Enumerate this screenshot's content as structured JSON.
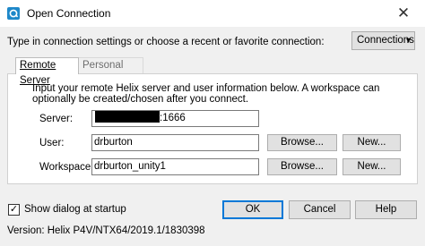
{
  "window": {
    "title": "Open Connection",
    "app_icon": "helix-p4v-icon",
    "close_glyph": "✕"
  },
  "instruction": "Type in connection settings or choose a recent or favorite connection:",
  "connections_button": {
    "label": "Connections",
    "arrow": "▾"
  },
  "tabs": [
    {
      "label": "Remote Server",
      "active": true
    },
    {
      "label": "Personal Server",
      "active": false
    }
  ],
  "panel": {
    "description": "Input your remote Helix server and user information below. A workspace can optionally be created/chosen after you connect.",
    "server": {
      "label": "Server:",
      "value_suffix": ":1666",
      "redacted": true
    },
    "user": {
      "label": "User:",
      "value": "drburton",
      "browse": "Browse...",
      "new": "New..."
    },
    "workspace": {
      "label": "Workspace:",
      "value": "drburton_unity1",
      "browse": "Browse...",
      "new": "New..."
    }
  },
  "show_dialog": {
    "label": "Show dialog at startup",
    "checked": true,
    "glyph": "✓"
  },
  "buttons": {
    "ok": "OK",
    "cancel": "Cancel",
    "help": "Help"
  },
  "version": "Version:   Helix P4V/NTX64/2019.1/1830398"
}
